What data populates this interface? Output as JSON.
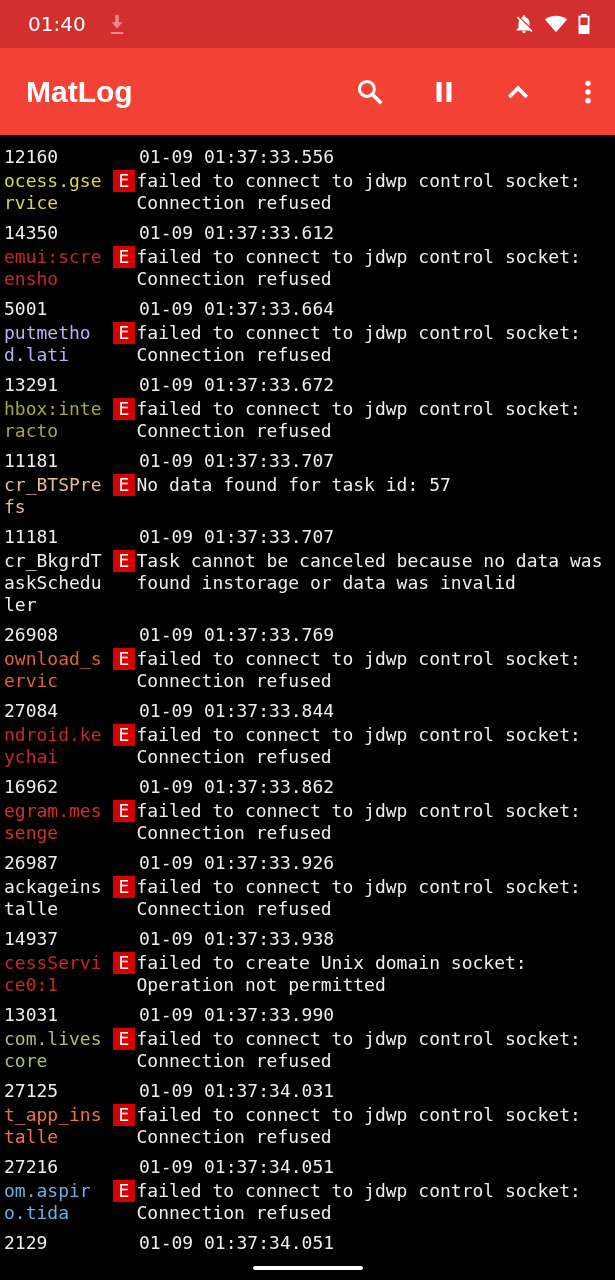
{
  "status_bar": {
    "time": "01:40"
  },
  "app_bar": {
    "title": "MatLog"
  },
  "log": [
    {
      "pid": "12160",
      "time": "01-09 01:37:33.556",
      "tag": "ocess.gservice",
      "color": "#d8d840",
      "level": "E",
      "message": "failed to connect to jdwp control socket: Connection refused"
    },
    {
      "pid": "14350",
      "time": "01-09 01:37:33.612",
      "tag": "emui:screensho",
      "color": "#c62828",
      "level": "E",
      "message": "failed to connect to jdwp control socket: Connection refused"
    },
    {
      "pid": "5001",
      "time": "01-09 01:37:33.664",
      "tag": "putmethod.lati",
      "color": "#b4b4ec",
      "level": "E",
      "message": "failed to connect to jdwp control socket: Connection refused"
    },
    {
      "pid": "13291",
      "time": "01-09 01:37:33.672",
      "tag": "hbox:interacto",
      "color": "#a8a838",
      "level": "E",
      "message": "failed to connect to jdwp control socket: Connection refused"
    },
    {
      "pid": "11181",
      "time": "01-09 01:37:33.707",
      "tag": "cr_BTSPrefs",
      "color": "#e4bc90",
      "level": "E",
      "message": "No data found for task id: 57"
    },
    {
      "pid": "11181",
      "time": "01-09 01:37:33.707",
      "tag": "cr_BkgrdTaskScheduler",
      "color": "#eeeeee",
      "level": "E",
      "message": "Task cannot be canceled because no data was found instorage or data was invalid"
    },
    {
      "pid": "26908",
      "time": "01-09 01:37:33.769",
      "tag": "ownload_servic",
      "color": "#e0603a",
      "level": "E",
      "message": "failed to connect to jdwp control socket: Connection refused"
    },
    {
      "pid": "27084",
      "time": "01-09 01:37:33.844",
      "tag": "ndroid.keychai",
      "color": "#c62828",
      "level": "E",
      "message": "failed to connect to jdwp control socket: Connection refused"
    },
    {
      "pid": "16962",
      "time": "01-09 01:37:33.862",
      "tag": "egram.messenge",
      "color": "#d32f2f",
      "level": "E",
      "message": "failed to connect to jdwp control socket: Connection refused"
    },
    {
      "pid": "26987",
      "time": "01-09 01:37:33.926",
      "tag": "ackageinstalle",
      "color": "#eeeeee",
      "level": "E",
      "message": "failed to connect to jdwp control socket: Connection refused"
    },
    {
      "pid": "14937",
      "time": "01-09 01:37:33.938",
      "tag": "cessService0:1",
      "color": "#c62828",
      "level": "E",
      "message": "failed to create Unix domain socket: Operation not permitted"
    },
    {
      "pid": "13031",
      "time": "01-09 01:37:33.990",
      "tag": "com.livescore",
      "color": "#a8c070",
      "level": "E",
      "message": "failed to connect to jdwp control socket: Connection refused"
    },
    {
      "pid": "27125",
      "time": "01-09 01:37:34.031",
      "tag": "t_app_installe",
      "color": "#f07050",
      "level": "E",
      "message": "failed to connect to jdwp control socket: Connection refused"
    },
    {
      "pid": "27216",
      "time": "01-09 01:37:34.051",
      "tag": "om.aspiro.tida",
      "color": "#6ab0e0",
      "level": "E",
      "message": "failed to connect to jdwp control socket: Connection refused"
    },
    {
      "pid": "2129",
      "time": "01-09 01:37:34.051"
    }
  ]
}
